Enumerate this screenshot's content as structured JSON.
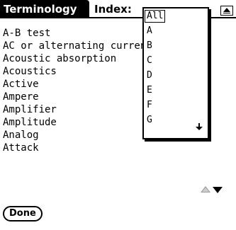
{
  "header": {
    "title": "Terminology",
    "index_label": "Index:"
  },
  "index_popup": {
    "items": [
      "All",
      "A",
      "B",
      "C",
      "D",
      "E",
      "F",
      "G"
    ],
    "selected": "All",
    "scroll_icon": "down-arrow-icon"
  },
  "terms": [
    "A-B test",
    "AC or alternating current",
    "Acoustic absorption",
    "Acoustics",
    "Active",
    "Ampere",
    "Amplifier",
    "Amplitude",
    "Analog",
    "Attack"
  ],
  "footer": {
    "done_label": "Done"
  }
}
